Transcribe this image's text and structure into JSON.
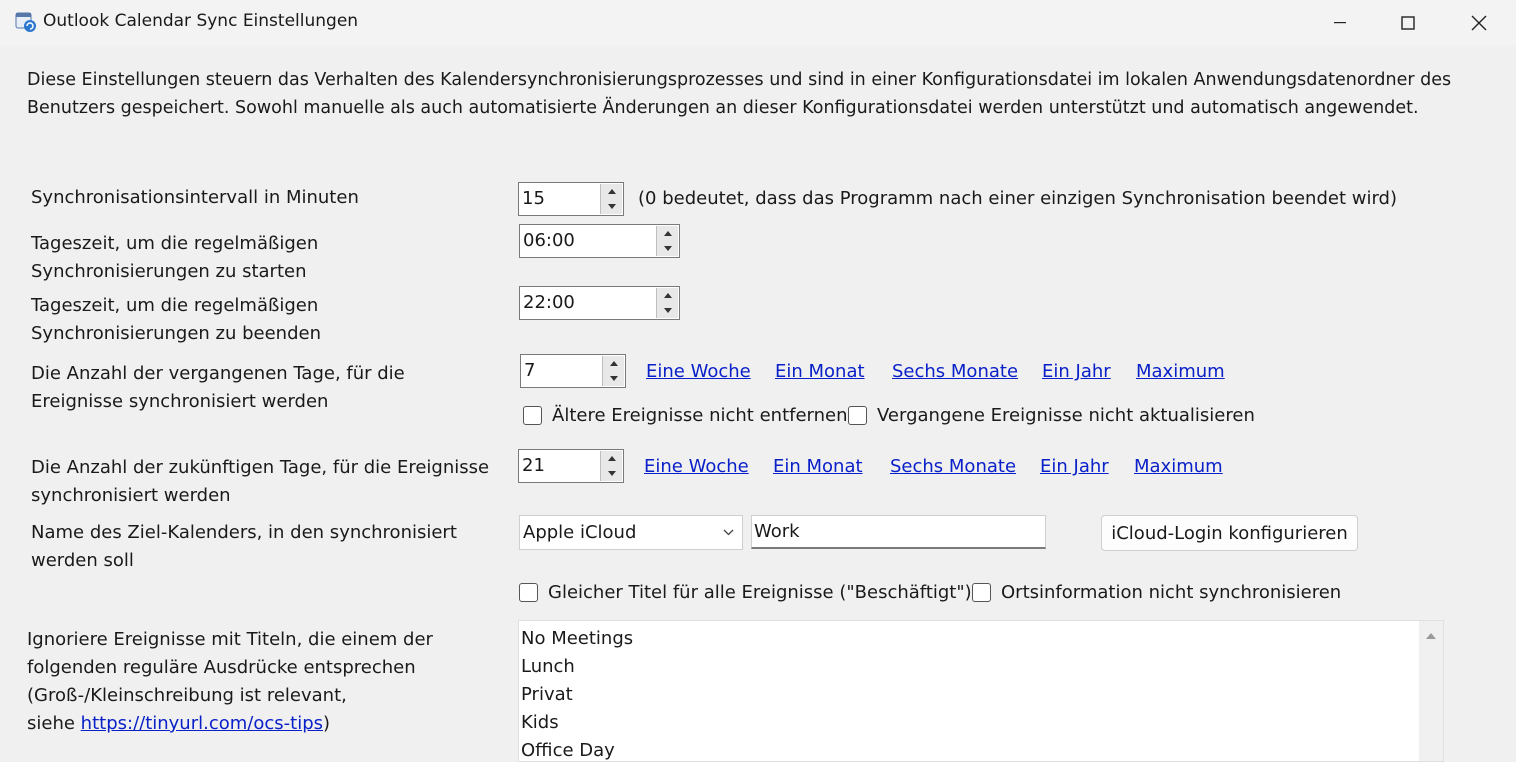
{
  "window": {
    "title": "Outlook Calendar Sync Einstellungen",
    "minimize_icon": "minimize-icon",
    "maximize_icon": "maximize-icon",
    "close_icon": "close-icon"
  },
  "description": "Diese Einstellungen steuern das Verhalten des Kalendersynchronisierungsprozesses und sind in einer Konfigurationsdatei im lokalen Anwendungsdatenordner des Benutzers gespeichert. Sowohl manuelle als auch automatisierte Änderungen an dieser Konfigurationsdatei werden unterstützt und automatisch angewendet.",
  "sync_interval": {
    "label": "Synchronisationsintervall in Minuten",
    "value": "15",
    "hint": "(0 bedeutet, dass das Programm nach einer einzigen Synchronisation beendet wird)"
  },
  "start_time": {
    "label": "Tageszeit, um die regelmäßigen Synchronisierungen zu starten",
    "value": "06:00"
  },
  "end_time": {
    "label": "Tageszeit, um die regelmäßigen Synchronisierungen zu beenden",
    "value": "22:00"
  },
  "past_days": {
    "label": "Die Anzahl der vergangenen Tage, für die Ereignisse synchronisiert werden",
    "value": "7",
    "links": [
      "Eine Woche",
      "Ein Monat",
      "Sechs Monate",
      "Ein Jahr",
      "Maximum"
    ],
    "checkboxes": [
      {
        "label": "Ältere Ereignisse nicht entfernen",
        "checked": false
      },
      {
        "label": "Vergangene Ereignisse nicht aktualisieren",
        "checked": false
      }
    ]
  },
  "future_days": {
    "label": "Die Anzahl der zukünftigen Tage, für die Ereignisse synchronisiert werden",
    "value": "21",
    "links": [
      "Eine Woche",
      "Ein Monat",
      "Sechs Monate",
      "Ein Jahr",
      "Maximum"
    ]
  },
  "target_calendar": {
    "label": "Name des Ziel-Kalenders, in den synchronisiert werden soll",
    "provider": "Apple iCloud",
    "calendar_name": "Work",
    "config_button": "iCloud-Login konfigurieren",
    "checkboxes": [
      {
        "label": "Gleicher Titel für alle Ereignisse (\"Beschäftigt\")",
        "checked": false
      },
      {
        "label": "Ortsinformation nicht synchronisieren",
        "checked": false
      }
    ]
  },
  "ignore_regex": {
    "label_line1": "Ignoriere Ereignisse mit Titeln, die einem der",
    "label_line2": "folgenden reguläre Ausdrücke entsprechen",
    "label_line3": "(Groß-/Kleinschreibung ist relevant,",
    "label_prefix": "siehe ",
    "link": "https://tinyurl.com/ocs-tips",
    "label_suffix": ")",
    "items": [
      "No Meetings",
      "Lunch",
      "Privat",
      "Kids",
      "Office Day"
    ]
  },
  "colors": {
    "link": "#0a20c8",
    "background": "#f0f0f0"
  }
}
